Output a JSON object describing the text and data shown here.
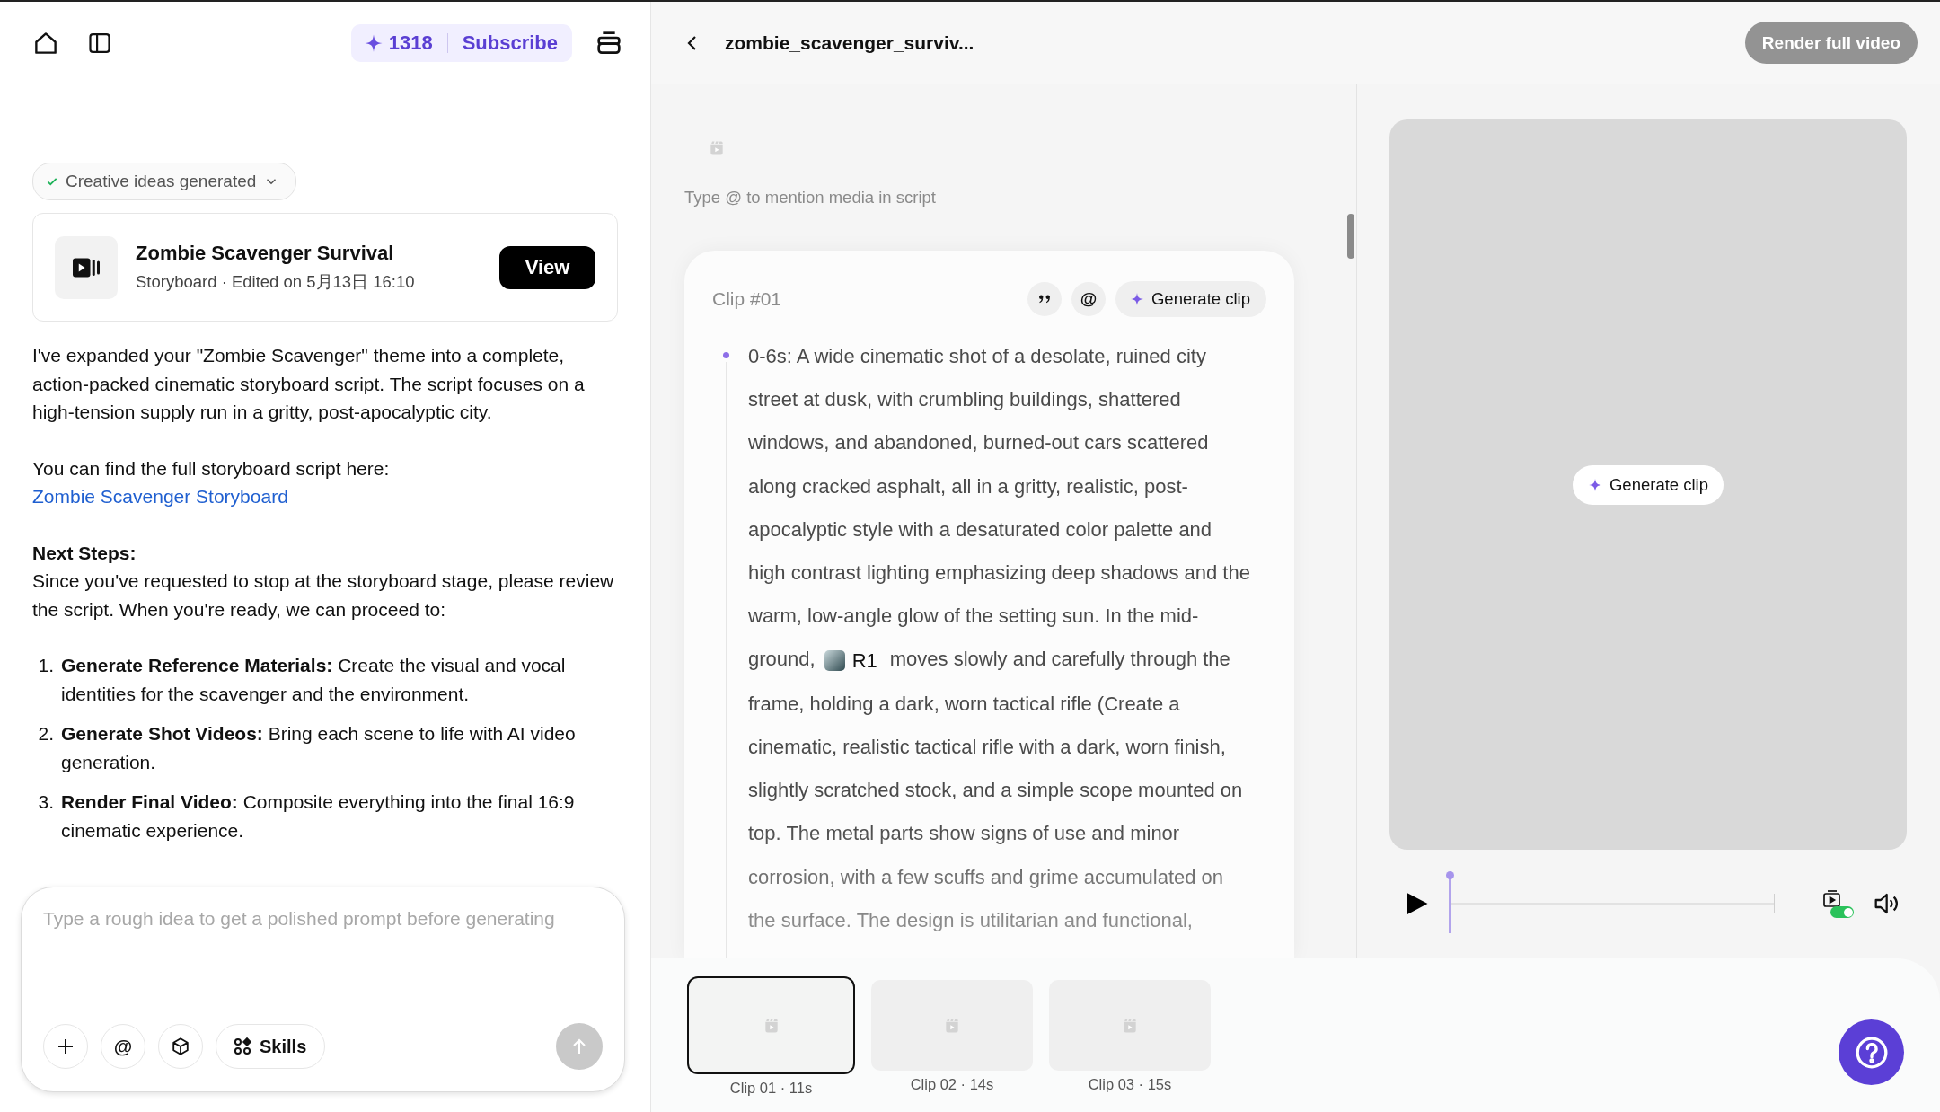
{
  "nav": {
    "credits": "1318",
    "subscribe": "Subscribe"
  },
  "status": {
    "label": "Creative ideas generated",
    "done": true
  },
  "project": {
    "title": "Zombie Scavenger Survival",
    "meta": "Storyboard · Edited on 5月13日 16:10",
    "action": "View"
  },
  "message": {
    "intro": "I've expanded your \"Zombie Scavenger\" theme into a complete, action-packed cinematic storyboard script. The script focuses on a high-tension supply run in a gritty, post-apocalyptic city.",
    "link_lead": "You can find the full storyboard script here:",
    "link": "Zombie Scavenger Storyboard",
    "heading": "Next Steps:",
    "body": "Since you've requested to stop at the storyboard stage, please review the script. When you're ready, we can proceed to:",
    "steps": [
      {
        "number": "1.",
        "text": "**Generate Reference Materials:** Create the visual and vocal identities for the scavenger and the environment."
      },
      {
        "number": "2.",
        "text": "**Generate Shot Videos:** Bring each scene to life with AI video generation."
      },
      {
        "number": "3.",
        "text": "**Render Final Video:** Composite everything into the final 16:9 cinematic experience."
      }
    ]
  },
  "composer": {
    "placeholder": "Type a rough idea to get a polished prompt before generating",
    "mention": "@",
    "skills": "Skills"
  },
  "editor": {
    "title": "zombie_scavenger_surviv...",
    "render": {
      "label": "Render full video",
      "disabled": true
    }
  },
  "script": {
    "hint": "Type @ to mention media in script",
    "clip": {
      "label": "Clip #01",
      "mention": "@",
      "generate": "Generate clip",
      "segments": [
        {
          "kind": "text",
          "text": "0-6s: A wide cinematic shot of a desolate, ruined city street at dusk, with crumbling buildings, shattered windows, and abandoned, burned-out cars scattered along cracked asphalt, all in a gritty, realistic, post-apocalyptic style with a desaturated color palette and high contrast lighting emphasizing deep shadows and the warm, low-angle glow of the setting sun. In the mid-ground,"
        },
        {
          "kind": "mention",
          "text": "R1"
        },
        {
          "kind": "text",
          "text": "moves slowly and carefully through the frame, holding a dark, worn tactical rifle (Create a cinematic, realistic tactical rifle with a dark, worn finish, slightly scratched stock, and a simple scope mounted on top. The metal parts show signs of use and minor corrosion, with a few scuffs and grime accumulated on the surface. The design is utilitarian and functional,"
        }
      ]
    }
  },
  "preview": {
    "generate": "Generate clip"
  },
  "player": {
    "level": 0,
    "autoplay": true
  },
  "timeline": [
    {
      "label": "Clip 01 · 11s",
      "selected": true
    },
    {
      "label": "Clip 02 · 14s",
      "selected": false
    },
    {
      "label": "Clip 03 · 15s",
      "selected": false
    }
  ]
}
